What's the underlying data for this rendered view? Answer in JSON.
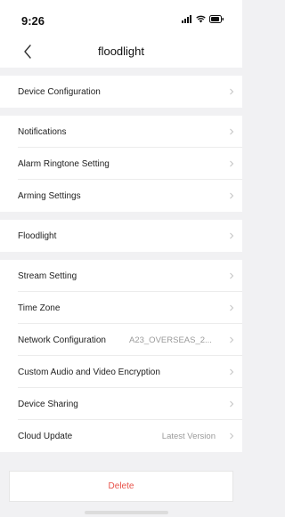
{
  "status_bar": {
    "time": "9:26"
  },
  "nav": {
    "title": "floodlight"
  },
  "groups": [
    {
      "items": [
        {
          "label": "Device Configuration"
        }
      ]
    },
    {
      "items": [
        {
          "label": "Notifications"
        },
        {
          "label": "Alarm Ringtone Setting"
        },
        {
          "label": "Arming Settings"
        }
      ]
    },
    {
      "items": [
        {
          "label": "Floodlight"
        }
      ]
    },
    {
      "items": [
        {
          "label": "Stream Setting"
        },
        {
          "label": "Time Zone"
        },
        {
          "label": "Network Configuration",
          "value": "A23_OVERSEAS_2..."
        },
        {
          "label": "Custom Audio and Video Encryption"
        },
        {
          "label": "Device Sharing"
        },
        {
          "label": "Cloud Update",
          "value": "Latest Version"
        }
      ]
    }
  ],
  "delete_label": "Delete",
  "colors": {
    "delete": "#e8524a",
    "background": "#f1f1f3"
  }
}
